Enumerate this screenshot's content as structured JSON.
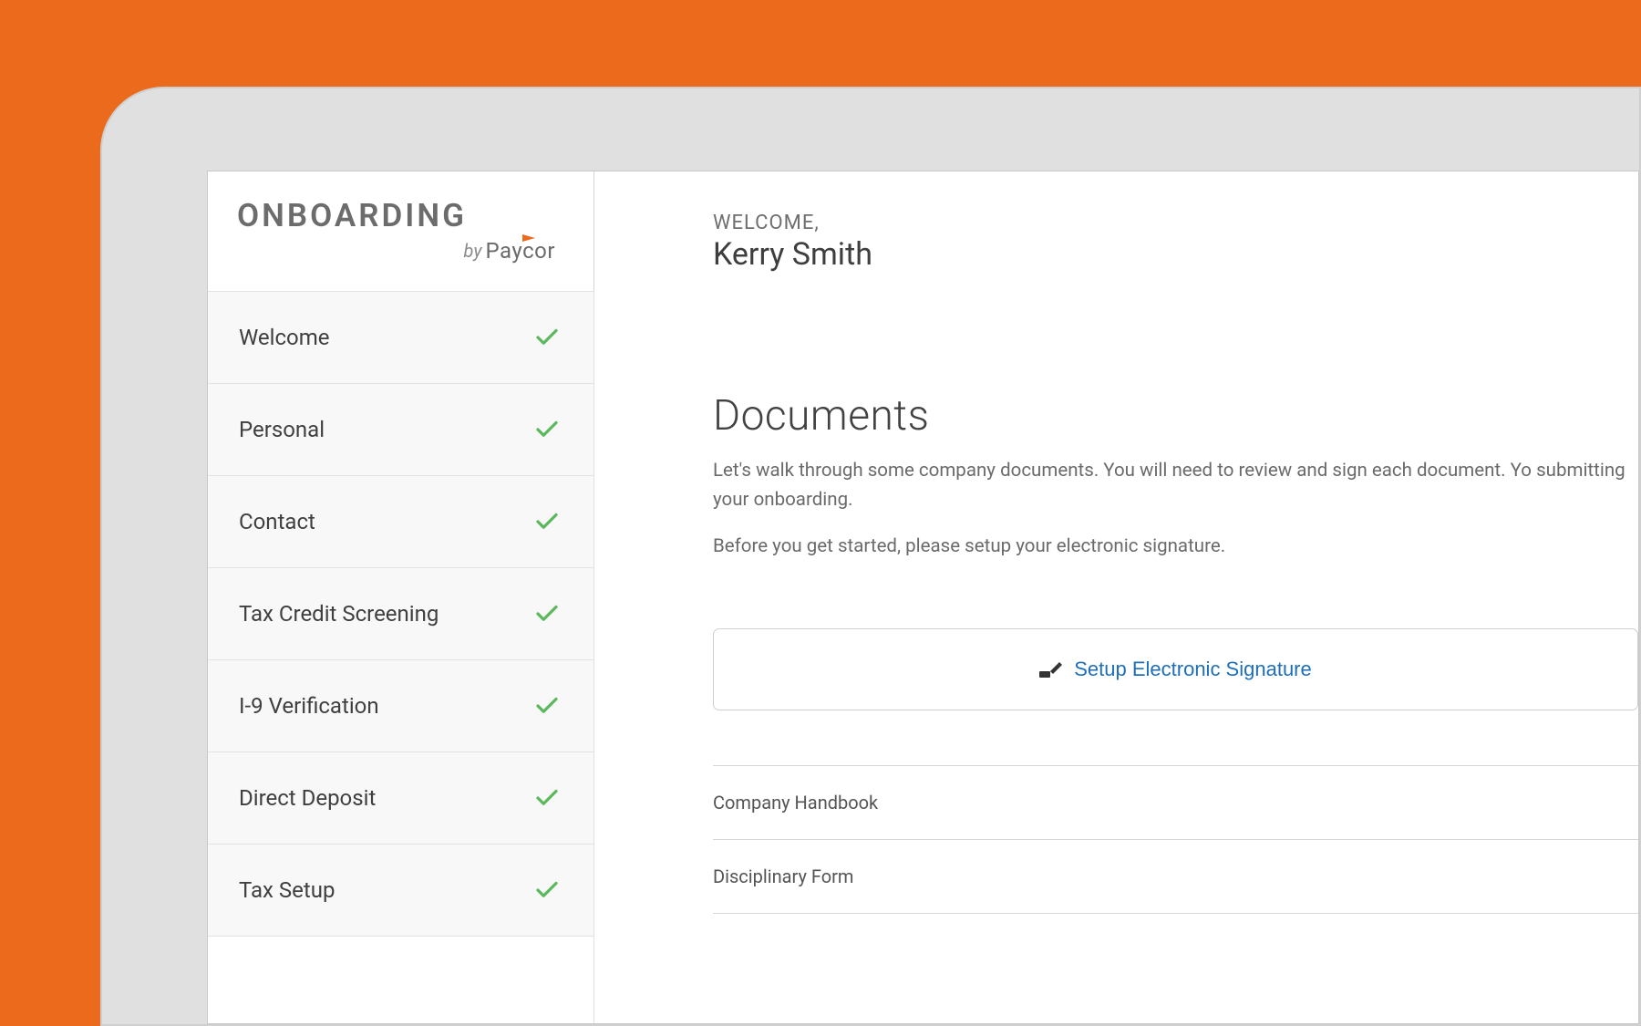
{
  "brand": {
    "title": "ONBOARDING",
    "by": "by",
    "company": "Paycor"
  },
  "sidebar": {
    "items": [
      {
        "label": "Welcome",
        "done": true
      },
      {
        "label": "Personal",
        "done": true
      },
      {
        "label": "Contact",
        "done": true
      },
      {
        "label": "Tax Credit Screening",
        "done": true
      },
      {
        "label": "I-9 Verification",
        "done": true
      },
      {
        "label": "Direct Deposit",
        "done": true
      },
      {
        "label": "Tax Setup",
        "done": true
      }
    ]
  },
  "header": {
    "welcome_label": "WELCOME,",
    "user_name": "Kerry Smith"
  },
  "main": {
    "title": "Documents",
    "intro_line1": "Let's walk through some company documents. You will need to review and sign each document. Yo submitting your onboarding.",
    "intro_line2": "Before you get started, please setup your electronic signature.",
    "signature_button_label": "Setup Electronic Signature",
    "documents": [
      {
        "name": "Company Handbook"
      },
      {
        "name": "Disciplinary Form"
      }
    ]
  },
  "colors": {
    "accent_orange": "#ec6a1c",
    "check_green": "#5cb85c",
    "link_blue": "#1f6fb8"
  }
}
